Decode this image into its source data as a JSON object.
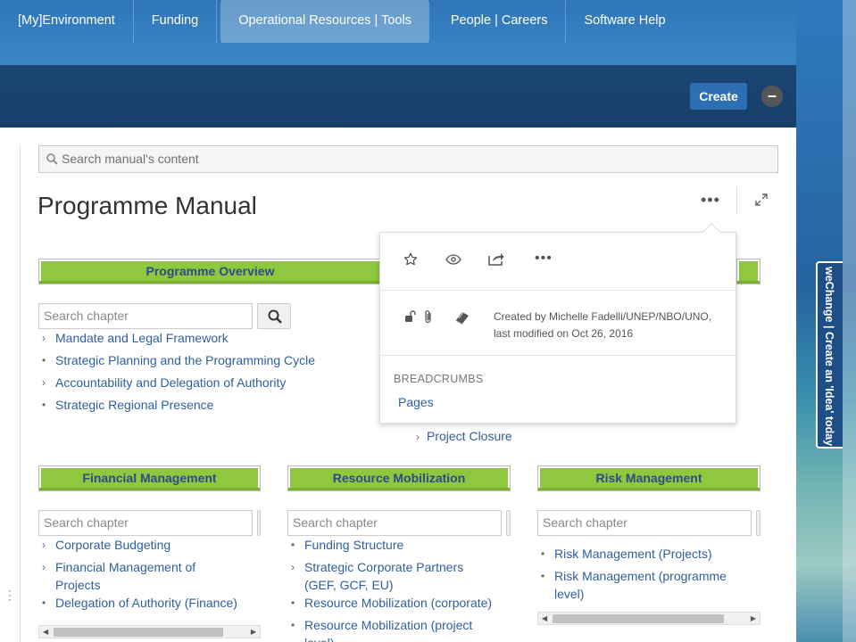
{
  "nav": {
    "items": [
      "[My]Environment",
      "Funding",
      "Operational Resources | Tools",
      "People | Careers",
      "Software Help"
    ],
    "active_index": 2
  },
  "header": {
    "create_label": "Create",
    "collapse_symbol": "–"
  },
  "search": {
    "placeholder": "Search manual's content"
  },
  "page": {
    "title": "Programme Manual",
    "more_label": "•••"
  },
  "sections": {
    "programme_overview": {
      "title": "Programme Overview",
      "search_placeholder": "Search chapter",
      "items": [
        {
          "bullet": "›",
          "label": "Mandate and Legal Framework"
        },
        {
          "bullet": "•",
          "label": "Strategic Planning and the Programming Cycle"
        },
        {
          "bullet": "›",
          "label": "Accountability and Delegation of Authority"
        },
        {
          "bullet": "•",
          "label": "Strategic Regional Presence"
        }
      ]
    },
    "project_closure": {
      "bullet": "›",
      "label": "Project Closure"
    },
    "financial_management": {
      "title": "Financial Management",
      "search_placeholder": "Search chapter",
      "items": [
        {
          "bullet": "›",
          "label": "Corporate Budgeting"
        },
        {
          "bullet": "›",
          "label": "Financial Management of Projects"
        },
        {
          "bullet": "•",
          "label": "Delegation of Authority (Finance)"
        }
      ]
    },
    "resource_mobilization": {
      "title": "Resource Mobilization",
      "search_placeholder": "Search chapter",
      "items": [
        {
          "bullet": "•",
          "label": "Funding Structure"
        },
        {
          "bullet": "›",
          "label": "Strategic Corporate Partners (GEF, GCF, EU)"
        },
        {
          "bullet": "•",
          "label": "Resource Mobilization (corporate)"
        },
        {
          "bullet": "•",
          "label": "Resource Mobilization (project level)"
        }
      ]
    },
    "risk_management": {
      "title": "Risk Management",
      "search_placeholder": "Search chapter",
      "items": [
        {
          "bullet": "•",
          "label": "Risk Management (Projects)"
        },
        {
          "bullet": "•",
          "label": "Risk Management (programme level)"
        }
      ]
    }
  },
  "popup": {
    "more_label": "•••",
    "created_text": "Created by Michelle Fadelli/UNEP/NBO/UNO, last modified on Oct 26, 2016",
    "breadcrumbs_title": "BREADCRUMBS",
    "breadcrumb_link": "Pages"
  },
  "wechange": {
    "label": "weChange | Create an 'Idea' today!"
  },
  "colors": {
    "section_header": "#8fc73e",
    "link": "#2e5f9e",
    "band": "#1b4674",
    "create": "#2e6fb3"
  }
}
